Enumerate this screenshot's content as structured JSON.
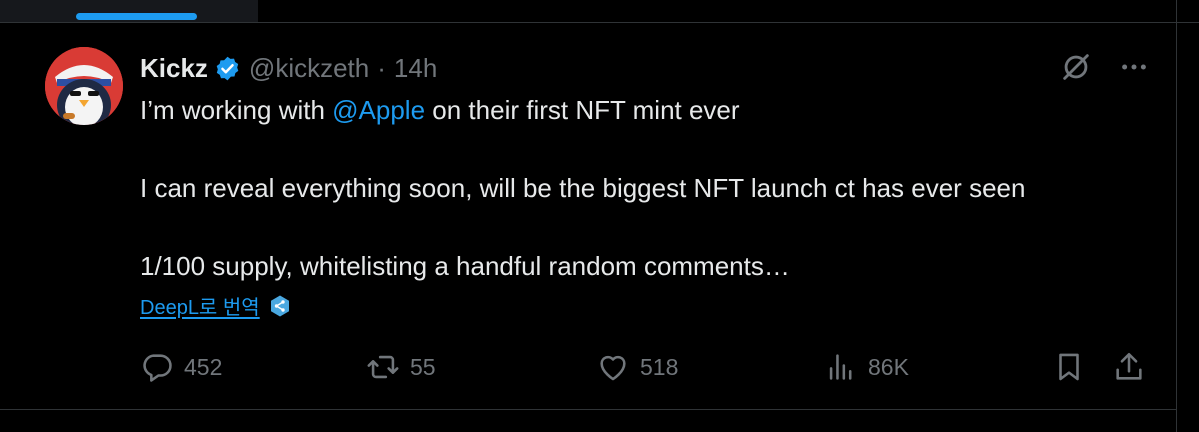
{
  "tweet": {
    "author_name": "Kickz",
    "handle": "@kickzeth",
    "separator": "·",
    "time": "14h",
    "text_before_mention": "I’m working with ",
    "mention": "@Apple",
    "text_after_mention": " on their first NFT mint ever\n\nI can reveal everything soon, will be the biggest NFT launch ct has ever seen\n\n1/100 supply, whitelisting a handful random comments…",
    "translate_label": "DeepL로 번역"
  },
  "actions": {
    "replies": "452",
    "reposts": "55",
    "likes": "518",
    "views": "86K"
  },
  "icons": {
    "verified": "verified-badge-icon",
    "grok": "slashed-circle-icon",
    "more": "more-dots-icon",
    "reply": "reply-icon",
    "repost": "repost-icon",
    "like": "heart-icon",
    "views": "views-icon",
    "bookmark": "bookmark-icon",
    "share": "share-icon",
    "translate": "deepl-icon"
  },
  "colors": {
    "background": "#000000",
    "text": "#e7e9ea",
    "muted": "#71767b",
    "accent": "#1d9bf0",
    "border": "#2f3336"
  }
}
